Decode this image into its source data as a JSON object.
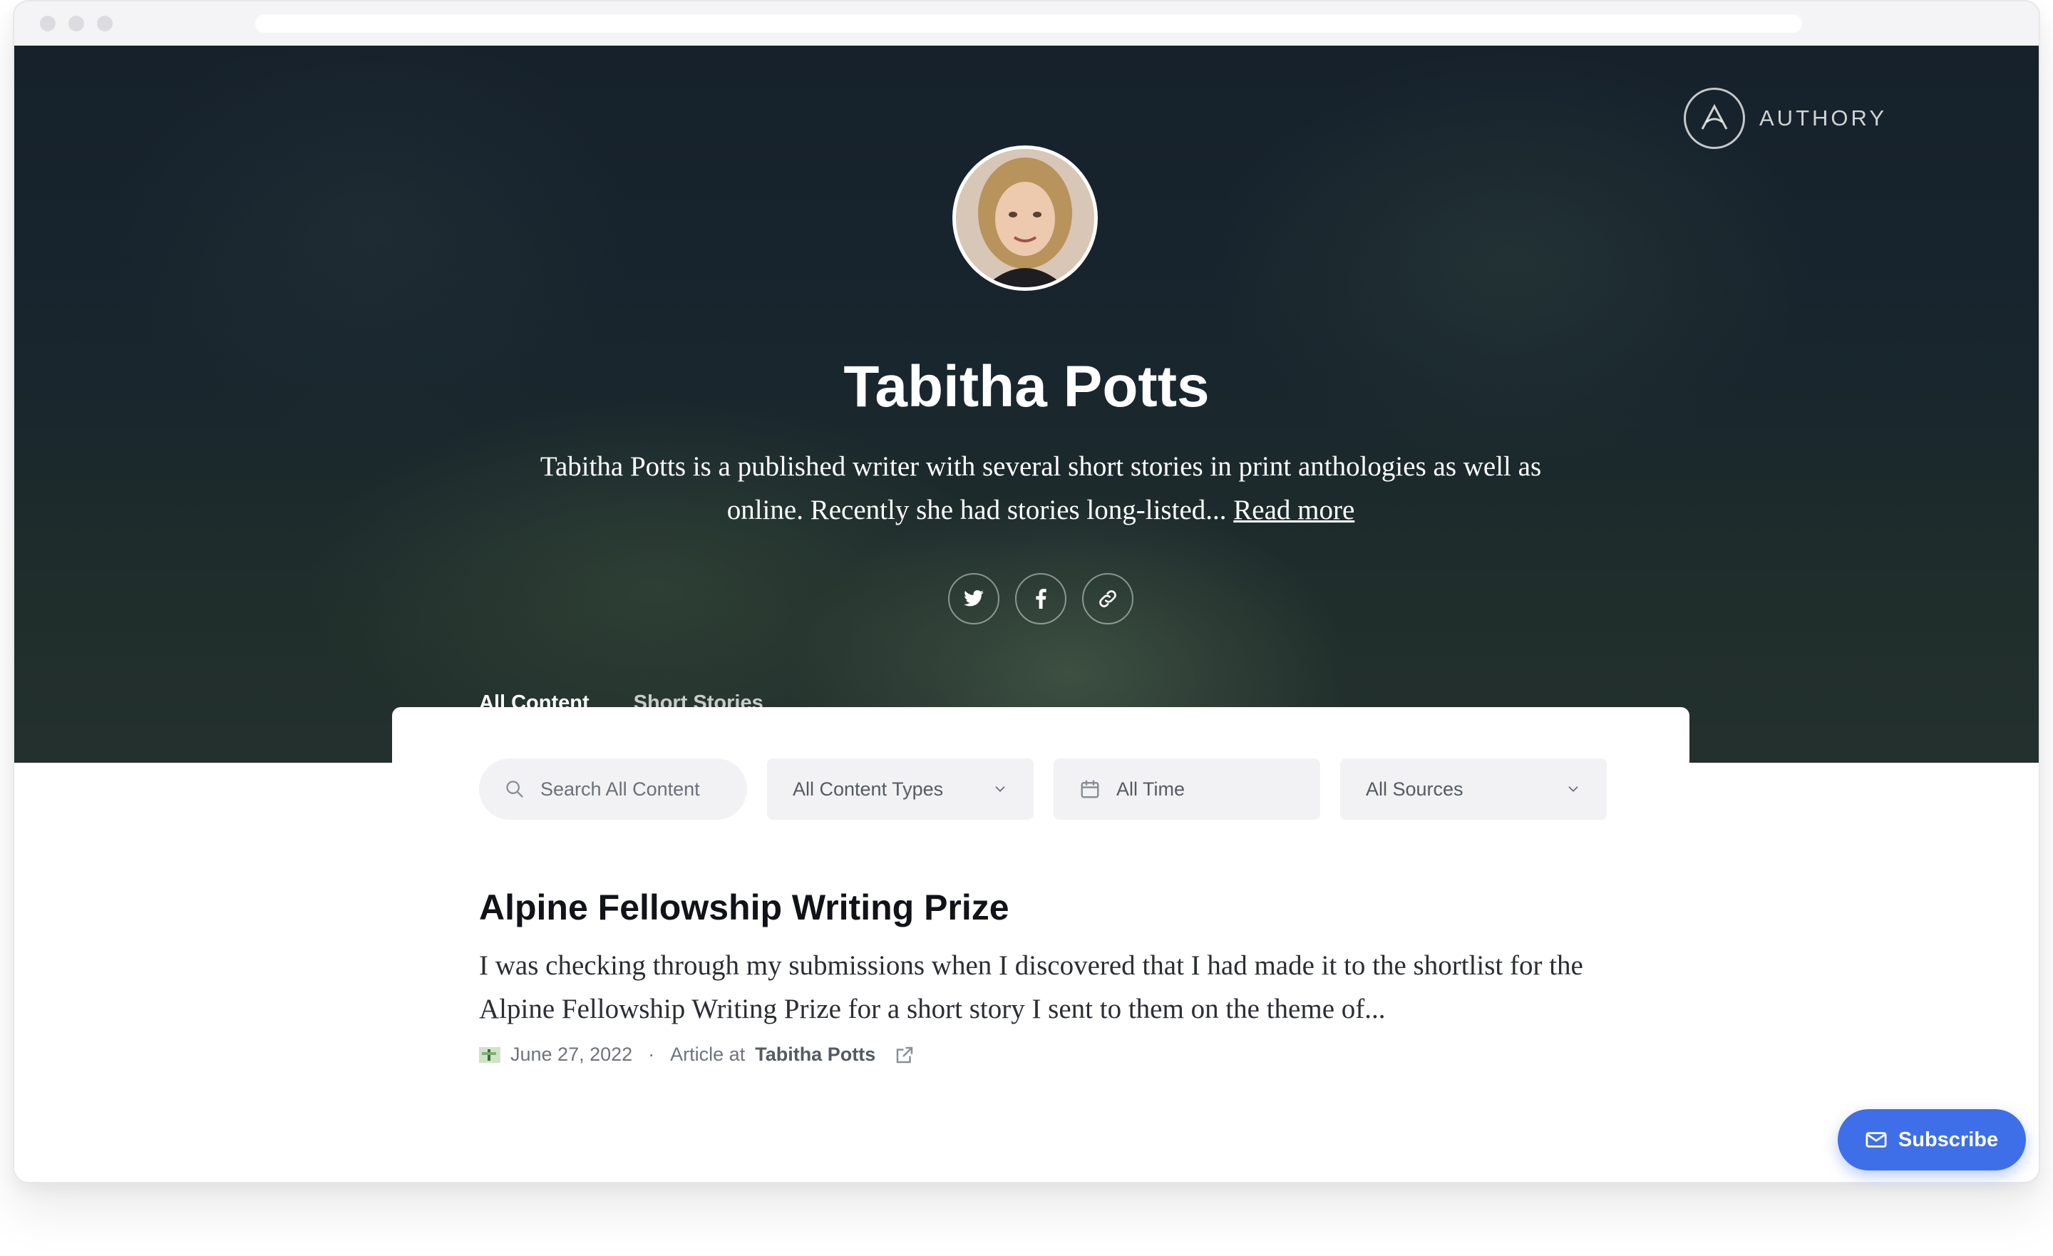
{
  "brand": {
    "name": "AUTHORY"
  },
  "profile": {
    "name": "Tabitha Potts",
    "bio": "Tabitha Potts is a published writer with several short stories in print anthologies as well as online. Recently she had stories long-listed...",
    "read_more": "Read more"
  },
  "socials": [
    {
      "icon": "twitter-icon"
    },
    {
      "icon": "facebook-icon"
    },
    {
      "icon": "link-icon"
    }
  ],
  "tabs": [
    {
      "label": "All Content",
      "active": true
    },
    {
      "label": "Short Stories",
      "active": false
    }
  ],
  "filters": {
    "search_placeholder": "Search All Content",
    "content_types": "All Content Types",
    "time": "All Time",
    "sources": "All Sources"
  },
  "article": {
    "title": "Alpine Fellowship Writing Prize",
    "excerpt": "I was checking through my submissions when I discovered that I had made it to the shortlist for the Alpine Fellowship Writing Prize for a short story I sent to them on the theme of...",
    "date": "June 27, 2022",
    "separator": "·",
    "type_prefix": "Article at",
    "publication": "Tabitha Potts"
  },
  "subscribe": {
    "label": "Subscribe"
  },
  "colors": {
    "accent": "#3f6fe8",
    "hero_dark": "#1c2a31",
    "text_dark": "#111318"
  }
}
